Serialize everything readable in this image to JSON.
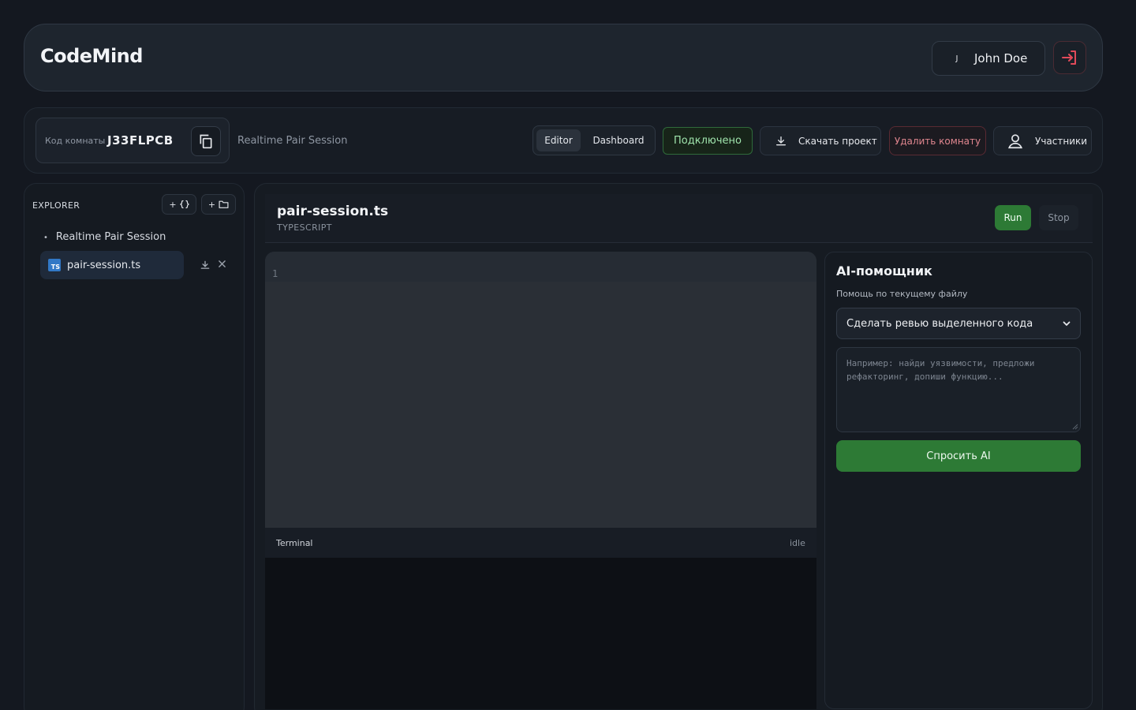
{
  "header": {
    "logo": "CodeMind",
    "user": {
      "initial": "J",
      "name": "John Doe"
    },
    "icons": {
      "logout": "logout-icon"
    }
  },
  "toolbar": {
    "room_label": "Код комнаты",
    "room_code": "J33FLPCB",
    "session_title": "Realtime Pair Session",
    "tabs": [
      {
        "label": "Editor",
        "active": true
      },
      {
        "label": "Dashboard",
        "active": false
      }
    ],
    "status": "Подключено",
    "download_label": "Скачать проект",
    "delete_label": "Удалить комнату",
    "participants_label": "Участники",
    "colors": {
      "connected": "#9fe3ac",
      "danger": "#e0868f",
      "accent_green": "#2d7a35"
    }
  },
  "explorer": {
    "title": "EXPLORER",
    "add_file_label": "+",
    "add_folder_label": "+",
    "project_name": "Realtime Pair Session",
    "files": [
      {
        "name": "pair-session.ts",
        "icon_text": "TS",
        "selected": true
      }
    ]
  },
  "editor": {
    "file_name": "pair-session.ts",
    "language": "TYPESCRIPT",
    "run_label": "Run",
    "stop_label": "Stop",
    "line_numbers": [
      "1"
    ],
    "terminal": {
      "title": "Terminal",
      "status": "idle"
    }
  },
  "ai": {
    "title": "AI-помощник",
    "subtitle": "Помощь по текущему файлу",
    "selected_action": "Сделать ревью выделенного кода",
    "placeholder": "Например: найди уязвимости, предложи рефакторинг, допиши функцию...",
    "ask_label": "Спросить AI"
  }
}
